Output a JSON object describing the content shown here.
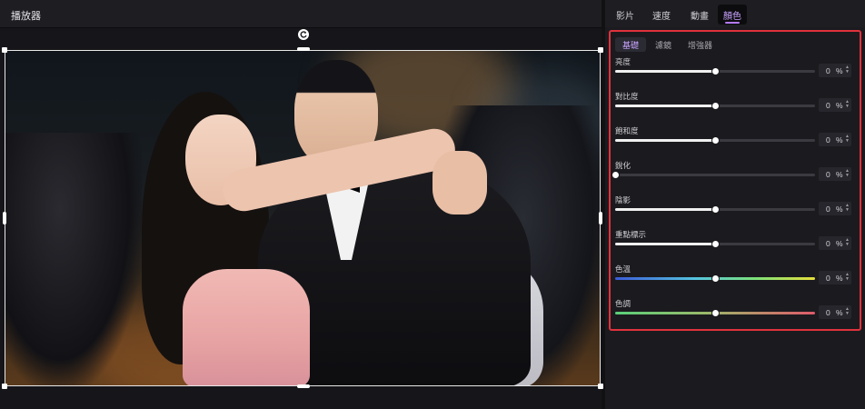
{
  "player": {
    "title": "播放器"
  },
  "tabs": [
    {
      "label": "影片",
      "active": false
    },
    {
      "label": "速度",
      "active": false
    },
    {
      "label": "動畫",
      "active": false
    },
    {
      "label": "顏色",
      "active": true
    }
  ],
  "subtabs": [
    {
      "label": "基礎",
      "active": true
    },
    {
      "label": "濾鏡",
      "active": false
    },
    {
      "label": "增強器",
      "active": false
    }
  ],
  "sliders": [
    {
      "label": "亮度",
      "value": "0",
      "unit": "%",
      "level": 0.5
    },
    {
      "label": "對比度",
      "value": "0",
      "unit": "%",
      "level": 0.5
    },
    {
      "label": "飽和度",
      "value": "0",
      "unit": "%",
      "level": 0.5
    },
    {
      "label": "銳化",
      "value": "0",
      "unit": "%",
      "level": 0.0
    },
    {
      "label": "陰影",
      "value": "0",
      "unit": "%",
      "level": 0.5
    },
    {
      "label": "重點標示",
      "value": "0",
      "unit": "%",
      "level": 0.5
    },
    {
      "label": "色溫",
      "value": "0",
      "unit": "%",
      "level": 0.5
    },
    {
      "label": "色調",
      "value": "0",
      "unit": "%",
      "level": 0.5
    }
  ],
  "colors": {
    "accent": "#b57bff",
    "highlight_border": "#e0323c",
    "panel_bg": "#1b1b1f"
  },
  "icons": {
    "rotate": "rotate-icon",
    "spin_up": "▲",
    "spin_down": "▼"
  }
}
